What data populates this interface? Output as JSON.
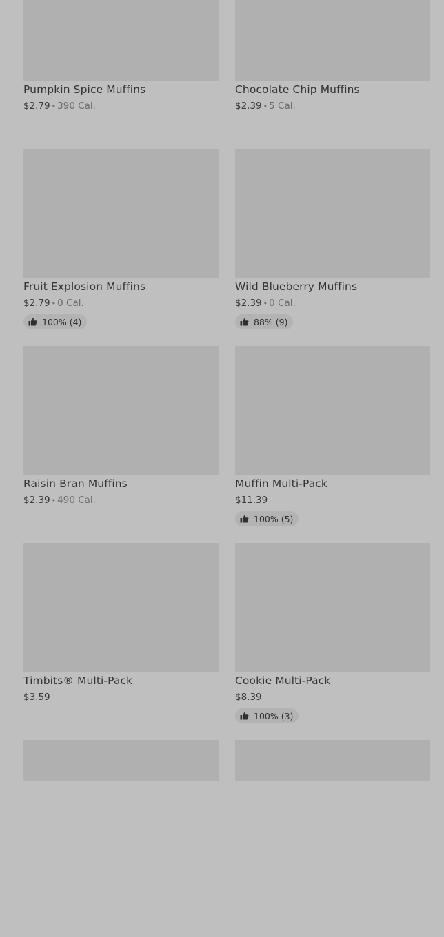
{
  "products": [
    {
      "name": "Pumpkin Spice Muffins",
      "price": "$2.79",
      "calories": "390 Cal.",
      "rating": null
    },
    {
      "name": "Chocolate Chip Muffins",
      "price": "$2.39",
      "calories": "5 Cal.",
      "rating": null
    },
    {
      "name": "Fruit Explosion Muffins",
      "price": "$2.79",
      "calories": "0 Cal.",
      "rating": "100% (4)"
    },
    {
      "name": "Wild Blueberry Muffins",
      "price": "$2.39",
      "calories": "0 Cal.",
      "rating": "88% (9)"
    },
    {
      "name": "Raisin Bran Muffins",
      "price": "$2.39",
      "calories": "490 Cal.",
      "rating": null
    },
    {
      "name": "Muffin Multi-Pack",
      "price": "$11.39",
      "calories": null,
      "rating": "100% (5)"
    },
    {
      "name": "Timbits® Multi-Pack",
      "price": "$3.59",
      "calories": null,
      "rating": null
    },
    {
      "name": "Cookie Multi-Pack",
      "price": "$8.39",
      "calories": null,
      "rating": "100% (3)"
    }
  ],
  "separator": "•",
  "icons": {
    "rating": "thumbs-up-icon"
  },
  "colors": {
    "background": "#bfbfbf",
    "image_placeholder": "#b0b0b0",
    "rating_pill": "#b3b3b3"
  }
}
